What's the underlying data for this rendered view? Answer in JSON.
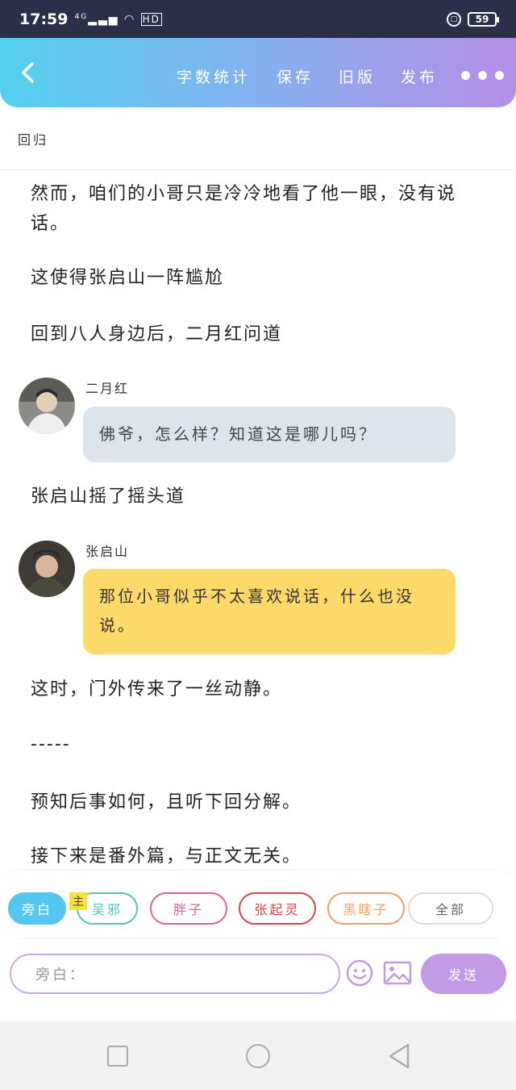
{
  "status_bar": {
    "time": "17:59",
    "network": "4G",
    "hd": "HD",
    "battery": "59"
  },
  "toolbar": {
    "word_count": "字数统计",
    "save": "保存",
    "old_version": "旧版",
    "publish": "发布"
  },
  "document": {
    "title": "回归"
  },
  "story": {
    "p1": "然而，咱们的小哥只是冷冷地看了他一眼，没有说话。",
    "p2": "这使得张启山一阵尴尬",
    "p3": "回到八人身边后，二月红问道",
    "msg1": {
      "speaker": "二月红",
      "text": "佛爷，怎么样？知道这是哪儿吗？"
    },
    "p4": "张启山摇了摇头道",
    "msg2": {
      "speaker": "张启山",
      "text": "那位小哥似乎不太喜欢说话，什么也没说。"
    },
    "p5": "这时，门外传来了一丝动静。",
    "separator": "-----",
    "p6": "预知后事如何，且听下回分解。",
    "p7": "接下来是番外篇，与正文无关。"
  },
  "roles": {
    "host_badge": "主",
    "items": [
      {
        "label": "旁白",
        "color": "#55c6ef"
      },
      {
        "label": "吴邪",
        "color": "#4fc7b0"
      },
      {
        "label": "胖子",
        "color": "#e0609a"
      },
      {
        "label": "张起灵",
        "color": "#d9453e"
      },
      {
        "label": "黑瞎子",
        "color": "#f0a060"
      },
      {
        "label": "全部",
        "color": "#cccccc"
      }
    ]
  },
  "composer": {
    "placeholder": "旁白：",
    "send": "发送"
  }
}
